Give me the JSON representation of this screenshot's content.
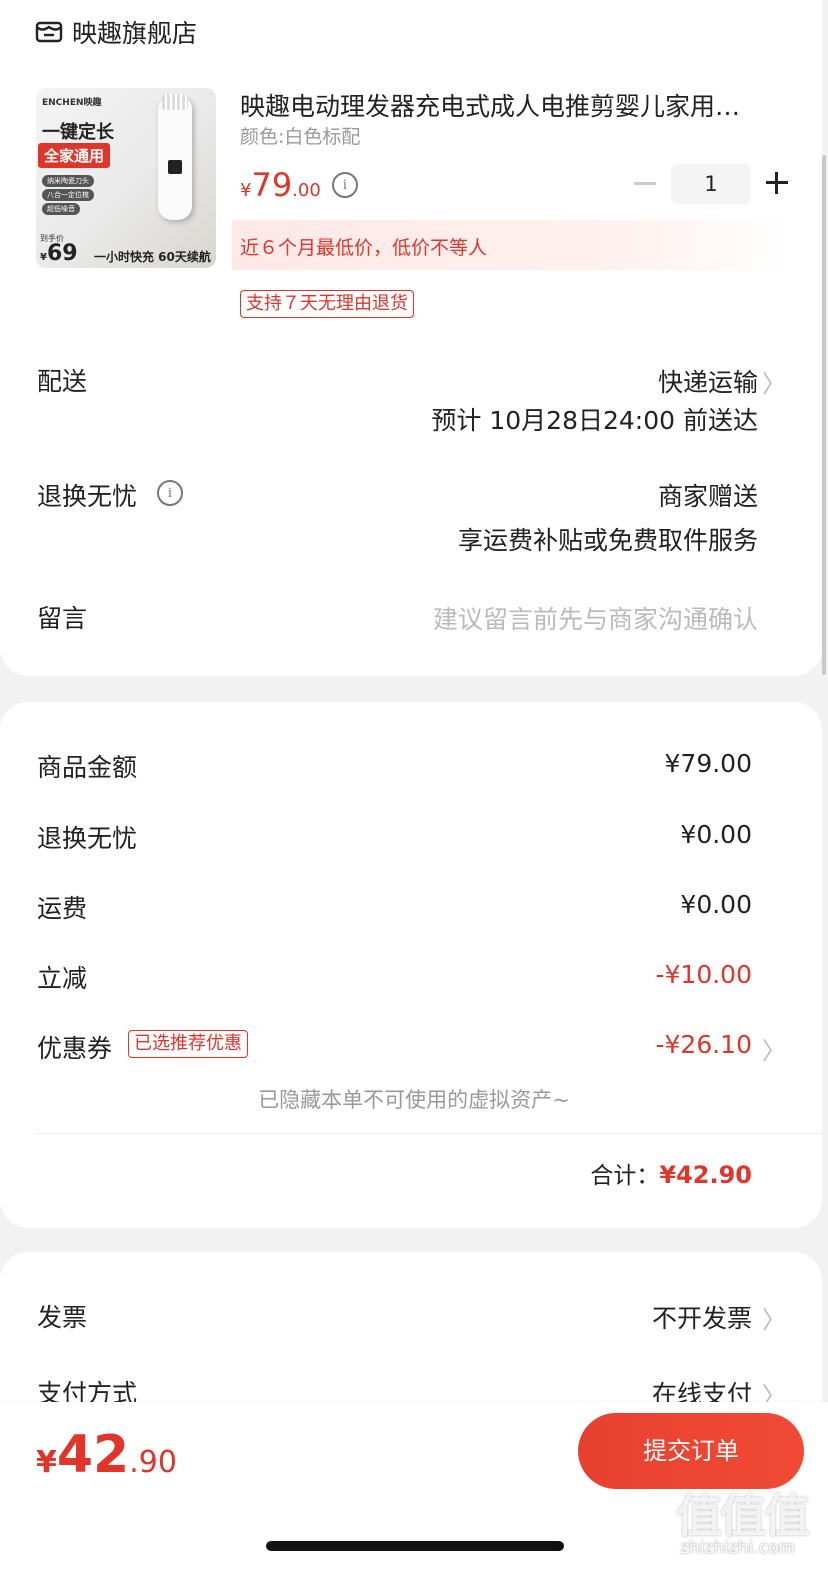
{
  "store": {
    "name": "映趣旗舰店",
    "icon": "shop-icon"
  },
  "product": {
    "title": "映趣电动理发器充电式成人电推剪婴儿家用…",
    "variant": "颜色:白色标配",
    "price_symbol": "¥",
    "price_int": "79",
    "price_dec": ".00",
    "quantity": "1",
    "low_price_note": "近６个月最低价，低价不等人",
    "return_tag": "支持７天无理由退货",
    "image": {
      "brand": "ENCHEN映趣",
      "headline": "一键定长",
      "banner": "全家通用",
      "features": [
        "纳米陶瓷刀头",
        "八合一定位梳",
        "超低噪音"
      ],
      "price_label": "到手价",
      "price_symbol": "¥",
      "price": "69",
      "footer": "一小时快充 60天续航"
    }
  },
  "delivery": {
    "label": "配送",
    "method": "快递运输",
    "eta": "预计 10月28日24:00 前送达"
  },
  "worry_free": {
    "label": "退换无忧",
    "value": "商家赠送",
    "sub": "享运费补贴或免费取件服务"
  },
  "message": {
    "label": "留言",
    "placeholder": "建议留言前先与商家沟通确认"
  },
  "summary": {
    "rows": [
      {
        "label": "商品金额",
        "value": "¥79.00"
      },
      {
        "label": "退换无忧",
        "value": "¥0.00"
      },
      {
        "label": "运费",
        "value": "¥0.00"
      },
      {
        "label": "立减",
        "value": "-¥10.00"
      }
    ],
    "coupon": {
      "label": "优惠券",
      "tag": "已选推荐优惠",
      "value": "-¥26.10"
    },
    "hidden_note": "已隐藏本单不可使用的虚拟资产",
    "total_label": "合计：",
    "total_value": "¥42.90"
  },
  "invoice": {
    "label": "发票",
    "value": "不开发票"
  },
  "payment": {
    "label": "支付方式",
    "value": "在线支付"
  },
  "bottom": {
    "price_symbol": "¥",
    "price_int": "42",
    "price_dec": ".90",
    "submit": "提交订单"
  },
  "watermark": {
    "glyphs": "值值值",
    "url": "zhizhizhi.com"
  },
  "colors": {
    "accent": "#e0352b",
    "background": "#f2f2f2"
  }
}
